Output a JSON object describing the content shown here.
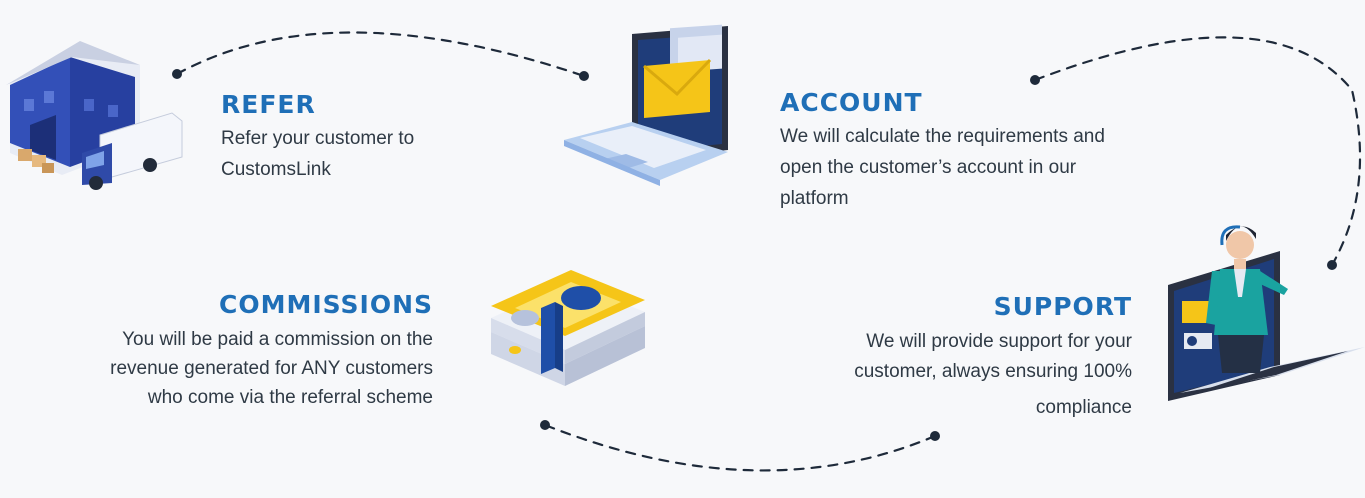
{
  "steps": {
    "refer": {
      "title": "REFER",
      "desc_line1": "Refer your customer to",
      "desc_line2": "CustomsLink"
    },
    "account": {
      "title": "ACCOUNT",
      "desc_line1": "We will calculate the requirements and",
      "desc_line2": "open the customer’s account in our",
      "desc_line3": "platform"
    },
    "commissions": {
      "title": "COMMISSIONS",
      "desc_line1": "You will be paid a commission on the",
      "desc_line2": "revenue generated for ANY customers",
      "desc_line3": "who come via the referral scheme"
    },
    "support": {
      "title": "SUPPORT",
      "desc_line1": "We will provide support for your",
      "desc_line2": "customer, always ensuring 100%",
      "desc_line3": "compliance"
    }
  },
  "colors": {
    "accent": "#1f6fb7",
    "text": "#2f3a45",
    "path": "#1e2a3a",
    "warehouse": "#2f4aa8",
    "laptop": "#5aa0e6",
    "money_yellow": "#f5c518"
  },
  "icons": [
    "warehouse-truck-icon",
    "laptop-email-icon",
    "money-stack-icon",
    "support-agent-laptop-icon"
  ]
}
